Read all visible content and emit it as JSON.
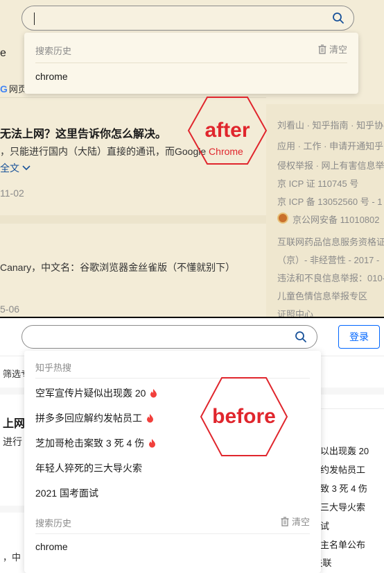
{
  "after": {
    "search": {
      "value": ""
    },
    "left_stub": "e",
    "dropdown": {
      "history_title": "搜索历史",
      "clear_label": "清空",
      "history_items": [
        "chrome"
      ]
    },
    "google_tab_letter": "G",
    "google_tab_label": "网页",
    "result1": {
      "title": "无法上网？这里告诉你怎么解决。",
      "snippet": "，只能进行国内（大陆）直接的通讯，而Google Chrome",
      "read_more": "全文",
      "date": "11-02"
    },
    "result2": {
      "snippet": "Canary，中文名：谷歌浏览器金丝雀版（不懂就别下）",
      "date": "5-06"
    },
    "footer_lines": [
      "刘看山 · 知乎指南 · 知乎协",
      "应用 · 工作 · 申请开通知乎",
      "侵权举报 · 网上有害信息举",
      "京 ICP 证 110745 号",
      "京 ICP 备 13052560 号 - 1",
      "京公网安备 11010802",
      "互联网药品信息服务资格证",
      "（京）- 非经营性 - 2017 - ",
      "违法和不良信息举报：010-",
      "儿童色情信息举报专区",
      "证照中心"
    ],
    "badge_label": "after"
  },
  "before": {
    "search": {
      "value": ""
    },
    "login_label": "登录",
    "tab_stub": "筛选专",
    "left_stub_title": "上网",
    "left_stub_text": "进行",
    "left_stub_bottom": "，中",
    "dropdown": {
      "hot_title": "知乎热搜",
      "hot_items": [
        "空军宣传片疑似出现轰 20",
        "拼多多回应解约发帖员工",
        "芝加哥枪击案致 3 死 4 伤",
        "年轻人猝死的三大导火索",
        "2021 国考面试"
      ],
      "hot_flames": [
        true,
        true,
        true,
        false,
        false
      ],
      "history_title": "搜索历史",
      "clear_label": "清空",
      "history_items": [
        "chrome"
      ]
    },
    "right_texts": [
      "以出现轰 20",
      "约发帖员工",
      "致 3 死 4 伤",
      "三大导火索",
      "试",
      "主名单公布",
      "印花 · 某航班失联"
    ],
    "badge_label": "before"
  },
  "colors": {
    "accent_red": "#e0262d",
    "brand_blue": "#0066ff",
    "sepia_bg": "#f3ecd7"
  }
}
